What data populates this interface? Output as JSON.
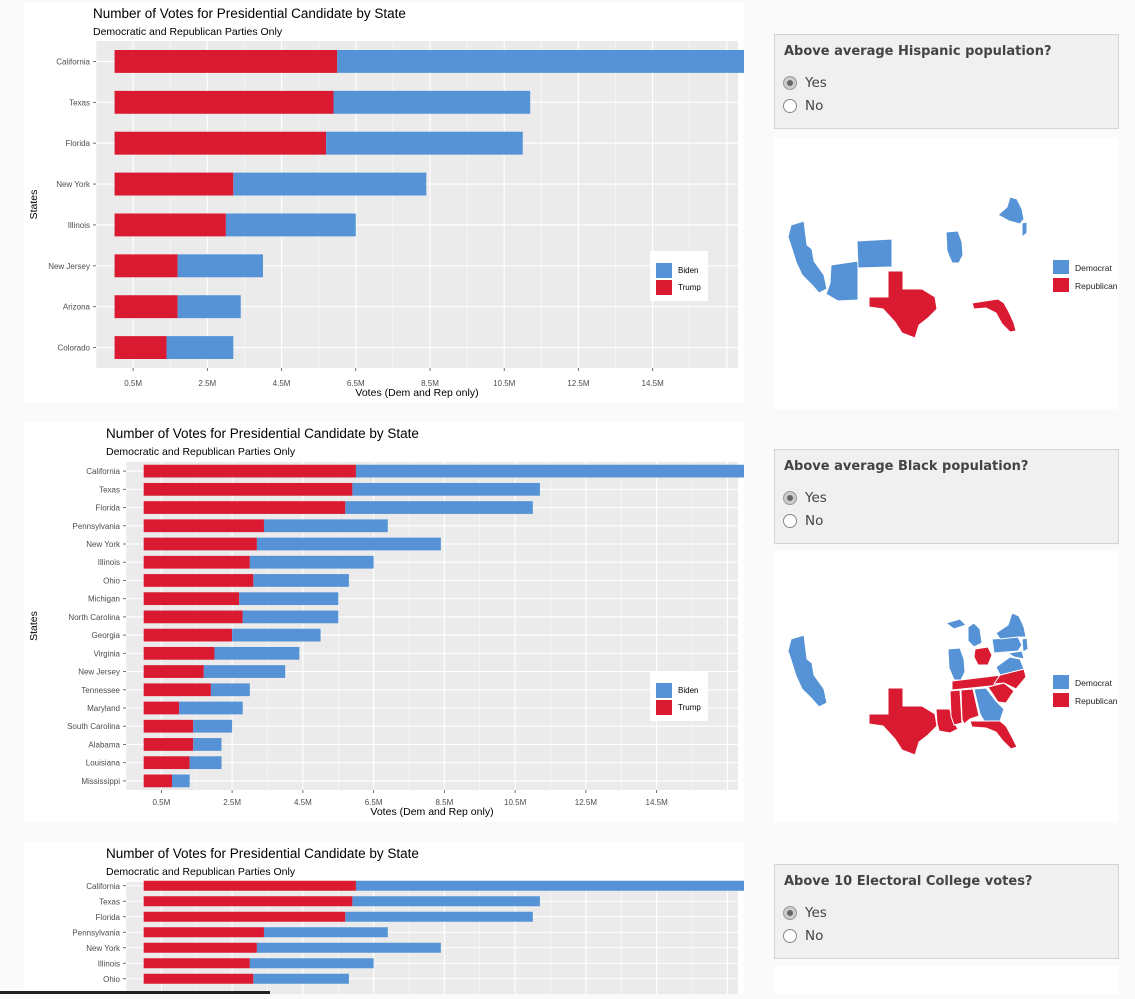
{
  "colors": {
    "biden": "#5593d6",
    "trump": "#d91a30",
    "plot_bg": "#ebebeb",
    "grid": "#ffffff"
  },
  "charts": [
    {
      "title": "Number of Votes for Presidential Candidate by State",
      "subtitle": "Democratic and Republican Parties Only",
      "xlabel": "Votes (Dem and Rep only)",
      "ylabel": "States",
      "legend": [
        "Biden",
        "Trump"
      ]
    },
    {
      "title": "Number of Votes for Presidential Candidate by State",
      "subtitle": "Democratic and Republican Parties Only",
      "xlabel": "Votes (Dem and Rep only)",
      "ylabel": "States",
      "legend": [
        "Biden",
        "Trump"
      ]
    },
    {
      "title": "Number of Votes for Presidential Candidate by State",
      "subtitle": "Democratic and Republican Parties Only",
      "xlabel": "",
      "ylabel": "",
      "legend": []
    }
  ],
  "chart_data": [
    {
      "type": "bar",
      "orientation": "horizontal",
      "stacked": true,
      "title": "Number of Votes for Presidential Candidate by State",
      "subtitle": "Democratic and Republican Parties Only",
      "xlabel": "Votes (Dem and Rep only)",
      "ylabel": "States",
      "categories": [
        "California",
        "Texas",
        "Florida",
        "New York",
        "Illinois",
        "New Jersey",
        "Arizona",
        "Colorado"
      ],
      "series": [
        {
          "name": "Trump",
          "values": [
            6.0,
            5.9,
            5.7,
            3.2,
            3.0,
            1.7,
            1.7,
            1.4
          ]
        },
        {
          "name": "Biden",
          "values": [
            11.1,
            5.3,
            5.3,
            5.2,
            3.5,
            2.3,
            1.7,
            1.8
          ]
        }
      ],
      "xticks": [
        "0.5M",
        "2.5M",
        "4.5M",
        "6.5M",
        "8.5M",
        "10.5M",
        "12.5M",
        "14.5M"
      ],
      "xlim": [
        -0.5,
        16.8
      ],
      "legend_position": "right",
      "grid": true
    },
    {
      "type": "bar",
      "orientation": "horizontal",
      "stacked": true,
      "title": "Number of Votes for Presidential Candidate by State",
      "subtitle": "Democratic and Republican Parties Only",
      "xlabel": "Votes (Dem and Rep only)",
      "ylabel": "States",
      "categories": [
        "California",
        "Texas",
        "Florida",
        "Pennsylvania",
        "New York",
        "Illinois",
        "Ohio",
        "Michigan",
        "North Carolina",
        "Georgia",
        "Virginia",
        "New Jersey",
        "Tennessee",
        "Maryland",
        "South Carolina",
        "Alabama",
        "Louisiana",
        "Mississippi"
      ],
      "series": [
        {
          "name": "Trump",
          "values": [
            6.0,
            5.9,
            5.7,
            3.4,
            3.2,
            3.0,
            3.1,
            2.7,
            2.8,
            2.5,
            2.0,
            1.7,
            1.9,
            1.0,
            1.4,
            1.4,
            1.3,
            0.8
          ]
        },
        {
          "name": "Biden",
          "values": [
            11.1,
            5.3,
            5.3,
            3.5,
            5.2,
            3.5,
            2.7,
            2.8,
            2.7,
            2.5,
            2.4,
            2.3,
            1.1,
            1.8,
            1.1,
            0.8,
            0.9,
            0.5
          ]
        }
      ],
      "xticks": [
        "0.5M",
        "2.5M",
        "4.5M",
        "6.5M",
        "8.5M",
        "10.5M",
        "12.5M",
        "14.5M"
      ],
      "xlim": [
        -0.5,
        16.8
      ],
      "legend_position": "right",
      "grid": true
    },
    {
      "type": "bar",
      "orientation": "horizontal",
      "stacked": true,
      "title": "Number of Votes for Presidential Candidate by State",
      "subtitle": "Democratic and Republican Parties Only",
      "xlabel": "",
      "ylabel": "",
      "categories": [
        "California",
        "Texas",
        "Florida",
        "Pennsylvania",
        "New York",
        "Illinois",
        "Ohio"
      ],
      "series": [
        {
          "name": "Trump",
          "values": [
            6.0,
            5.9,
            5.7,
            3.4,
            3.2,
            3.0,
            3.1
          ]
        },
        {
          "name": "Biden",
          "values": [
            11.1,
            5.3,
            5.3,
            3.5,
            5.2,
            3.5,
            2.7
          ]
        }
      ],
      "xticks": [],
      "xlim": [
        -0.5,
        16.8
      ],
      "legend_position": "",
      "grid": true
    }
  ],
  "controls": [
    {
      "label": "Above average Hispanic population?",
      "options": [
        "Yes",
        "No"
      ],
      "selected": "Yes"
    },
    {
      "label": "Above average Black population?",
      "options": [
        "Yes",
        "No"
      ],
      "selected": "Yes"
    },
    {
      "label": "Above 10 Electoral College votes?",
      "options": [
        "Yes",
        "No"
      ],
      "selected": "Yes"
    }
  ],
  "maps": [
    {
      "legend": [
        "Democrat",
        "Republican"
      ]
    },
    {
      "legend": [
        "Democrat",
        "Republican"
      ]
    }
  ]
}
